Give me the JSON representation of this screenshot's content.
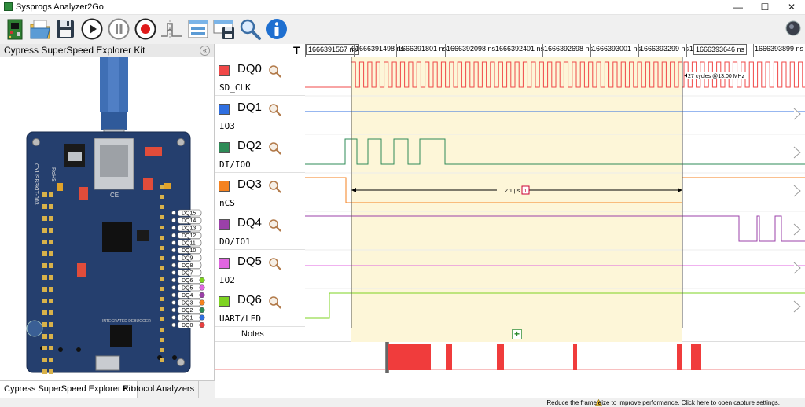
{
  "window": {
    "title": "Sysprogs Analyzer2Go",
    "minimize": "—",
    "maximize": "☐",
    "close": "✕"
  },
  "toolbar": {
    "buttons": [
      "board-icon",
      "open-icon",
      "save-icon",
      "play-icon",
      "pause-icon",
      "record-icon",
      "trigger-icon",
      "layout-icon",
      "save-layout-icon",
      "zoom-icon",
      "info-icon"
    ]
  },
  "left_panel": {
    "title": "Cypress SuperSpeed Explorer Kit",
    "collapse": "«",
    "board_text": {
      "model": "CYUSB3KIT-003",
      "rohs": "RoHS",
      "ce": "CE",
      "integrated": "INTEGRATED  DEBUGGER"
    },
    "pin_labels": [
      "DQ15",
      "DQ14",
      "DQ13",
      "DQ12",
      "DQ11",
      "DQ10",
      "DQ9",
      "DQ8",
      "DQ7",
      "DQ6",
      "DQ5",
      "DQ4",
      "DQ3",
      "DQ2",
      "DQ1",
      "DQ0"
    ],
    "pin_colors": [
      "",
      "",
      "",
      "",
      "",
      "",
      "",
      "",
      "",
      "#7ed321",
      "#e066e0",
      "#9b40a8",
      "#f5821f",
      "#2e8b57",
      "#2f6fe0",
      "#e84040"
    ],
    "tabs": [
      "Cypress SuperSpeed Explorer Kit",
      "Protocol Analyzers"
    ]
  },
  "timeline": {
    "t_label": "T",
    "ticks": [
      "1666391498 ns",
      "1666391801 ns",
      "1666392098 ns",
      "1666392401 ns",
      "1666392698 ns",
      "1666393001 ns",
      "1666393299 ns"
    ],
    "after_marker_tick": "1666393899 ns",
    "marker_left": "1666391567 ns",
    "marker_right": "1666393646 ns",
    "extra_left": "6",
    "extra_right": "1"
  },
  "channels": [
    {
      "name": "DQ0",
      "sub": "SD_CLK",
      "color": "#f04848"
    },
    {
      "name": "DQ1",
      "sub": "IO3",
      "color": "#2f6fe0"
    },
    {
      "name": "DQ2",
      "sub": "DI/IO0",
      "color": "#2e8b57"
    },
    {
      "name": "DQ3",
      "sub": "nCS",
      "color": "#f5821f"
    },
    {
      "name": "DQ4",
      "sub": "DO/IO1",
      "color": "#9b40a8"
    },
    {
      "name": "DQ5",
      "sub": "IO2",
      "color": "#e066e0"
    },
    {
      "name": "DQ6",
      "sub": "UART/LED",
      "color": "#7ed321"
    }
  ],
  "annotations": {
    "duration": "2.1 µs",
    "duration_tag": "1",
    "clock": "27 cycles @13.00 MHz"
  },
  "notes": {
    "label": "Notes",
    "add": "+"
  },
  "status": {
    "message": "Reduce the frame size to improve performance. Click here to open capture settings."
  },
  "colors": {
    "selection": "#fdf6d8",
    "selection_border": "#555555",
    "overview_red": "#f03c3c"
  }
}
